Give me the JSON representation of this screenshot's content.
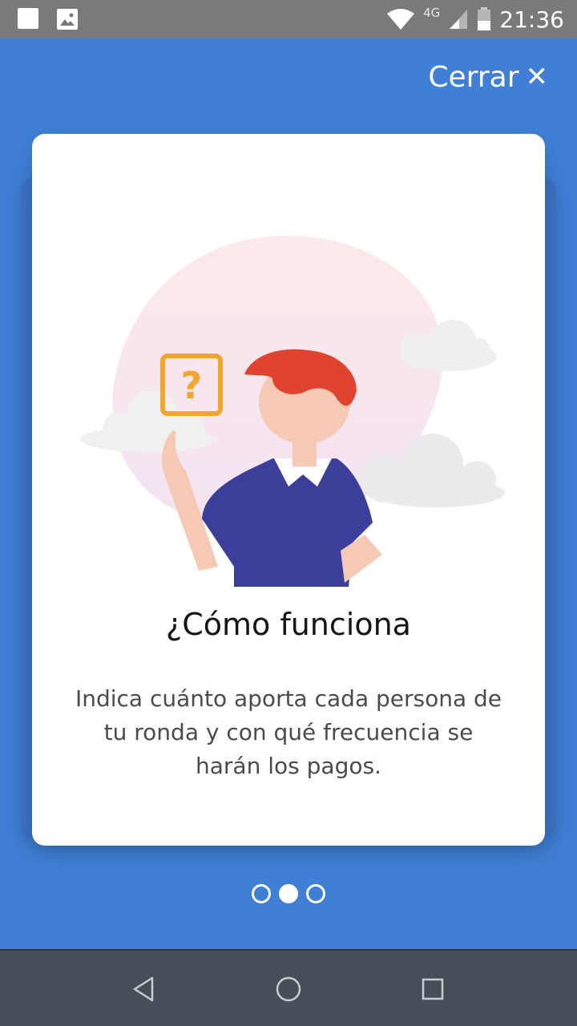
{
  "status_bar": {
    "network": "4G",
    "time": "21:36"
  },
  "header": {
    "close_label": "Cerrar",
    "close_icon": "close-icon"
  },
  "card": {
    "title": "¿Cómo funciona",
    "body": "Indica cuánto aporta cada persona de tu ronda y con qué frecuencia se harán los pagos.",
    "illustration": {
      "question_mark": "?"
    }
  },
  "pager": {
    "total": 3,
    "active_index": 1
  },
  "nav_bar": {
    "buttons": [
      "back-icon",
      "home-icon",
      "recents-icon"
    ]
  },
  "colors": {
    "background": "#3f80d6",
    "accent_orange": "#f3a531",
    "hair_red": "#e0442f",
    "shirt_blue": "#3b3f9a"
  }
}
